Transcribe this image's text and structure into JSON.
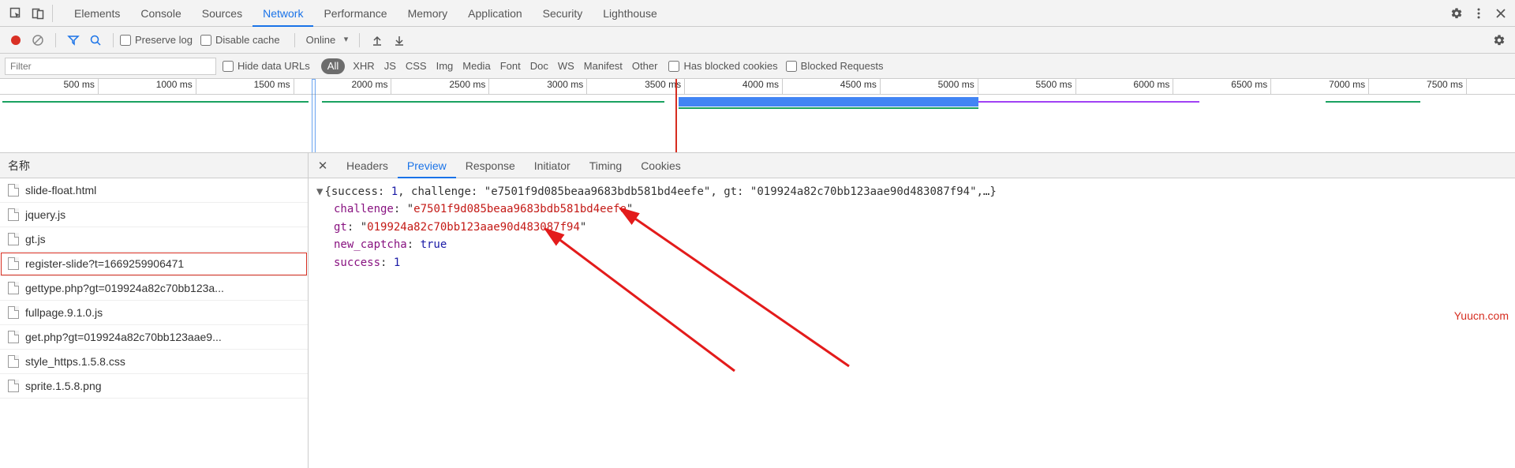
{
  "top_tabs": {
    "items": [
      "Elements",
      "Console",
      "Sources",
      "Network",
      "Performance",
      "Memory",
      "Application",
      "Security",
      "Lighthouse"
    ],
    "active_index": 3
  },
  "toolbar": {
    "preserve_log": "Preserve log",
    "disable_cache": "Disable cache",
    "throttling": "Online"
  },
  "filter": {
    "placeholder": "Filter",
    "hide_data_urls": "Hide data URLs",
    "all_pill": "All",
    "types": [
      "XHR",
      "JS",
      "CSS",
      "Img",
      "Media",
      "Font",
      "Doc",
      "WS",
      "Manifest",
      "Other"
    ],
    "has_blocked_cookies": "Has blocked cookies",
    "blocked_requests": "Blocked Requests"
  },
  "timeline": {
    "ticks": [
      "500 ms",
      "1000 ms",
      "1500 ms",
      "2000 ms",
      "2500 ms",
      "3000 ms",
      "3500 ms",
      "4000 ms",
      "4500 ms",
      "5000 ms",
      "5500 ms",
      "6000 ms",
      "6500 ms",
      "7000 ms",
      "7500 ms"
    ]
  },
  "left": {
    "header": "名称",
    "files": [
      "slide-float.html",
      "jquery.js",
      "gt.js",
      "register-slide?t=1669259906471",
      "gettype.php?gt=019924a82c70bb123a...",
      "fullpage.9.1.0.js",
      "get.php?gt=019924a82c70bb123aae9...",
      "style_https.1.5.8.css",
      "sprite.1.5.8.png"
    ],
    "selected_index": 3
  },
  "detail_tabs": {
    "items": [
      "Headers",
      "Preview",
      "Response",
      "Initiator",
      "Timing",
      "Cookies"
    ],
    "active_index": 1
  },
  "preview": {
    "summary_prefix": "{success: ",
    "summary_success": "1",
    "summary_mid1": ", challenge: \"",
    "summary_challenge": "e7501f9d085beaa9683bdb581bd4eefe",
    "summary_mid2": "\", gt: \"",
    "summary_gt": "019924a82c70bb123aae90d483087f94",
    "summary_end": "\",…}",
    "k_challenge": "challenge",
    "v_challenge": "e7501f9d085beaa9683bdb581bd4eefe",
    "k_gt": "gt",
    "v_gt": "019924a82c70bb123aae90d483087f94",
    "k_new_captcha": "new_captcha",
    "v_new_captcha": "true",
    "k_success": "success",
    "v_success": "1"
  },
  "watermark": "Yuucn.com"
}
